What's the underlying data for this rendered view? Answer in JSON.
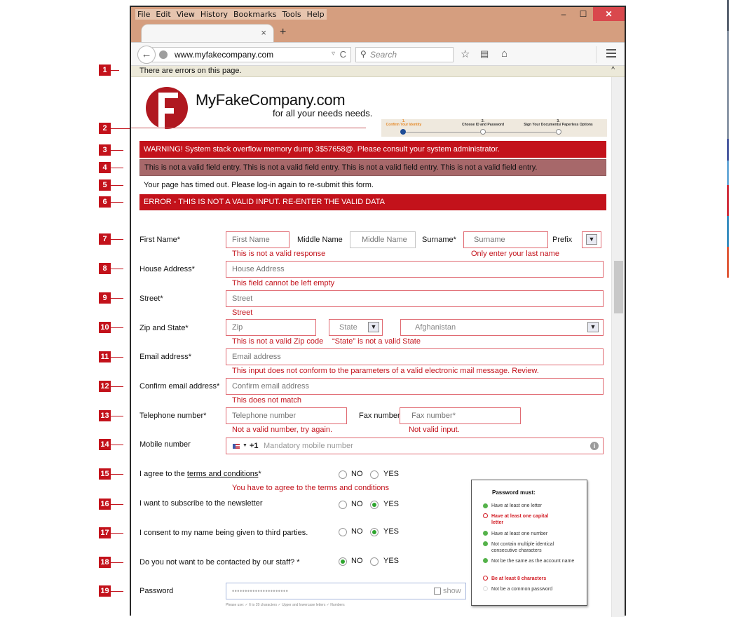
{
  "browser": {
    "menu": [
      "File",
      "Edit",
      "View",
      "History",
      "Bookmarks",
      "Tools",
      "Help"
    ],
    "window_controls": {
      "minimize": "–",
      "maximize": "☐",
      "close": "✕"
    },
    "tab": {
      "title": "",
      "close": "×",
      "new_tab": "+"
    },
    "url": "www.myfakecompany.com",
    "search_placeholder": "Search",
    "icons": {
      "back": "arrow-left",
      "globe": "globe",
      "dropdown": "▿",
      "reload": "C",
      "search": "magnifier",
      "bookmark": "☆",
      "reader": "clipboard",
      "home": "⌂",
      "menu": "hamburger"
    },
    "infobar": {
      "text": "There are errors on this page.",
      "collapse": "^"
    }
  },
  "annotations": [
    "1",
    "2",
    "3",
    "4",
    "5",
    "6",
    "7",
    "8",
    "9",
    "10",
    "11",
    "12",
    "13",
    "14",
    "15",
    "16",
    "17",
    "18",
    "19"
  ],
  "header": {
    "brand": "MyFakeCompany.com",
    "tagline": "for all your needs needs.",
    "logo_letter": "F",
    "brand_color": "#b01820"
  },
  "progress": {
    "steps": [
      {
        "number": "1.",
        "label": "Confirm Your Identity",
        "state": "active"
      },
      {
        "number": "2.",
        "label": "Choose ID and Password",
        "state": "pending"
      },
      {
        "number": "3.",
        "label": "Sign Your Documents/ Paperless Options",
        "state": "pending"
      }
    ]
  },
  "banners": {
    "warning": "WARNING! System stack overflow memory dump 3$57658@. Please consult your system administrator.",
    "invalid_entries": "This is not a valid field entry. This is not a valid field entry.  This is not a valid field entry.  This is not a valid field entry.",
    "timeout": "Your page has timed out. Please log-in again to re-submit this form.",
    "error": "ERROR - THIS IS NOT A VALID INPUT.    RE-ENTER THE VALID DATA"
  },
  "form": {
    "first_name": {
      "label": "First Name*",
      "placeholder": "First Name",
      "error": "This is not a valid response"
    },
    "middle_name": {
      "label": "Middle Name",
      "placeholder": "Middle Name"
    },
    "surname": {
      "label": "Surname*",
      "placeholder": "Surname",
      "error": "Only enter your last name"
    },
    "prefix": {
      "label": "Prefix",
      "value": ""
    },
    "house_address": {
      "label": "House Address*",
      "placeholder": "House Address",
      "error": "This field cannot be left empty"
    },
    "street": {
      "label": "Street*",
      "placeholder": "Street",
      "error": "Street"
    },
    "zip_state": {
      "label": "Zip and State*",
      "zip_placeholder": "Zip",
      "state_value": "State",
      "country_value": "Afghanistan",
      "zip_error": "This is not a valid Zip code",
      "state_error": "“State” is not a valid State"
    },
    "email": {
      "label": "Email address*",
      "placeholder": "Email address",
      "error": "This input does not conform to the parameters of a valid electronic mail message. Review."
    },
    "confirm_email": {
      "label": "Confirm email address*",
      "placeholder": "Confirm email address",
      "error": "This does not match"
    },
    "telephone": {
      "label": "Telephone number*",
      "placeholder": "Telephone number",
      "error": "Not a valid number, try again."
    },
    "fax": {
      "label": "Fax number*",
      "placeholder": "Fax number*",
      "error": "Not valid input."
    },
    "mobile": {
      "label": "Mobile number",
      "country_code": "+1",
      "placeholder": "Mandatory mobile number",
      "flag": "US"
    },
    "terms": {
      "label_prefix": "I agree to the ",
      "link": "terms and conditions",
      "label_suffix": "*",
      "selected": null,
      "error": "You have to agree to the terms and conditions"
    },
    "newsletter": {
      "label": "I want to subscribe to the newsletter",
      "selected": "YES"
    },
    "third_parties": {
      "label": "I consent to my name being given to third parties.",
      "selected": "YES"
    },
    "no_contact": {
      "label": "Do you not want to be contacted by our staff? *",
      "selected": "NO"
    },
    "radio_options": {
      "no": "NO",
      "yes": "YES"
    },
    "password": {
      "label": "Password",
      "masked_value": "••••••••••••••••••••••",
      "show_label": "show",
      "hint": "Please use:  ✓ 6 to 20 characters   ✓ Upper and lowercase letters   ✓ Numbers"
    }
  },
  "password_rules": {
    "title": "Password must:",
    "rules": [
      {
        "text": "Have at least one letter",
        "status": "pass"
      },
      {
        "text": "Have at least one capital letter",
        "status": "fail"
      },
      {
        "text": "Have at least one number",
        "status": "pass"
      },
      {
        "text": "Not contain multiple identical consecutive characters",
        "status": "pass"
      },
      {
        "text": "Not be the same as the account name",
        "status": "pass"
      },
      {
        "text": "Be at least 8 characters",
        "status": "fail"
      },
      {
        "text": "Not be a common password",
        "status": "neutral"
      }
    ]
  },
  "colors": {
    "error_red": "#c3121b",
    "banner_mauve": "#a7686a",
    "window_frame": "#d59e7f",
    "success_green": "#2ea52e"
  }
}
